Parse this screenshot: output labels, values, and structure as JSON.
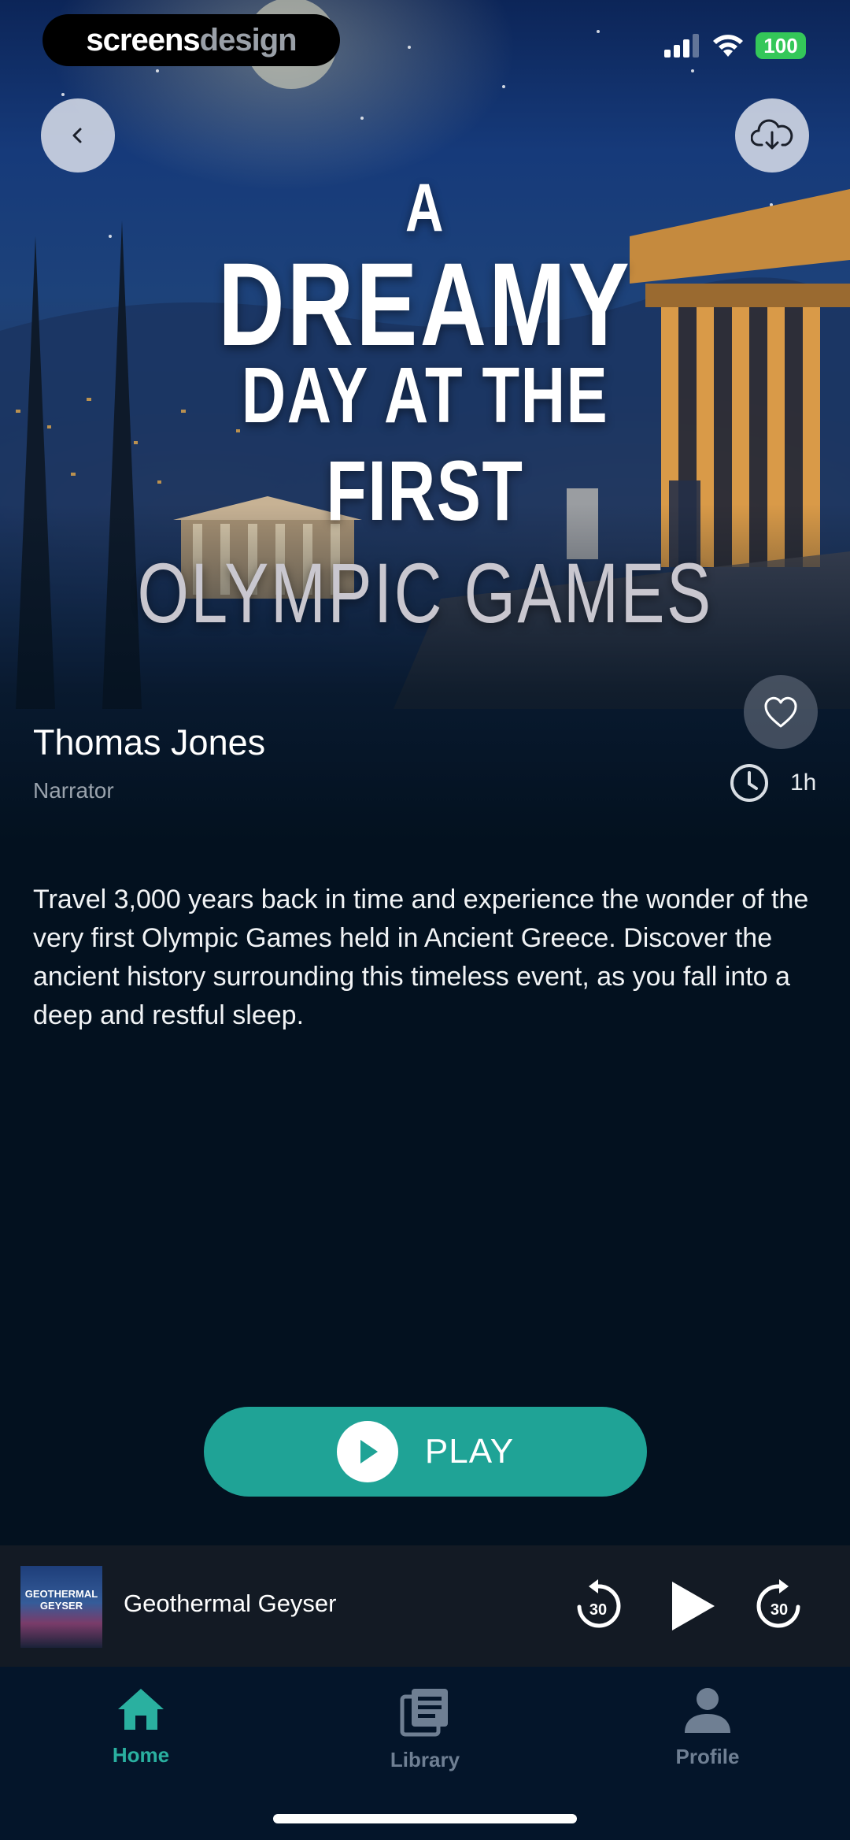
{
  "brand": {
    "part1": "screens",
    "part2": "design"
  },
  "status_bar": {
    "battery": "100"
  },
  "cover": {
    "line1": "A",
    "line2": "DREAMY",
    "line3": "DAY AT THE",
    "line4": "FIRST",
    "line5": "OLYMPIC GAMES"
  },
  "story": {
    "narrator_name": "Thomas Jones",
    "narrator_label": "Narrator",
    "duration": "1h",
    "description": "Travel 3,000 years back in time and experience the wonder of the very first Olympic Games held in Ancient Greece. Discover the ancient history surrounding this timeless event, as you fall into a deep and restful sleep."
  },
  "play_button": {
    "label": "PLAY"
  },
  "mini_player": {
    "title": "Geothermal Geyser",
    "art_text": "GEOTHERMAL GEYSER",
    "skip_seconds": "30"
  },
  "tabs": [
    {
      "label": "Home",
      "icon": "home-icon",
      "active": true
    },
    {
      "label": "Library",
      "icon": "library-icon",
      "active": false
    },
    {
      "label": "Profile",
      "icon": "profile-icon",
      "active": false
    }
  ],
  "colors": {
    "accent": "#1fa396",
    "tab_active": "#2ab0a0",
    "tab_inactive": "#6f7f93",
    "background": "#03111f"
  }
}
